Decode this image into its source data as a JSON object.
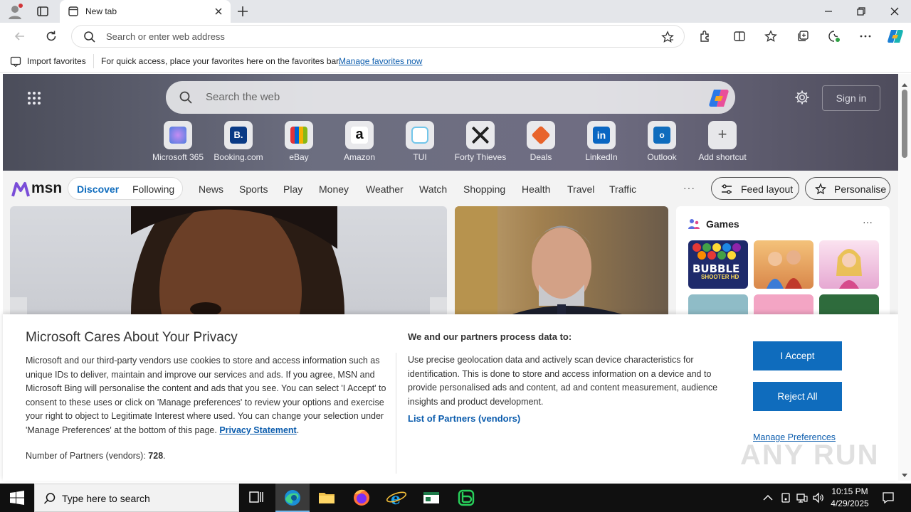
{
  "browser": {
    "tab_title": "New tab",
    "address_placeholder": "Search or enter web address"
  },
  "favorites_bar": {
    "import_label": "Import favorites",
    "message": "For quick access, place your favorites here on the favorites bar.",
    "manage_link": "Manage favorites now"
  },
  "newtab": {
    "search_placeholder": "Search the web",
    "sign_in": "Sign in",
    "shortcuts": [
      {
        "label": "Microsoft 365",
        "color": "#7b5cc9"
      },
      {
        "label": "Booking.com",
        "color": "#0a3a85"
      },
      {
        "label": "eBay",
        "color": "#e53238"
      },
      {
        "label": "Amazon",
        "color": "#222222"
      },
      {
        "label": "TUI",
        "color": "#72c6ea"
      },
      {
        "label": "Forty Thieves",
        "color": "#333333"
      },
      {
        "label": "Deals",
        "color": "#e8632b"
      },
      {
        "label": "LinkedIn",
        "color": "#0a66c2"
      },
      {
        "label": "Outlook",
        "color": "#0f6cbd"
      },
      {
        "label": "Add shortcut",
        "color": "#555555"
      }
    ]
  },
  "msn": {
    "logo": "msn",
    "tab_active": "Discover",
    "tab_other": "Following",
    "nav": [
      "News",
      "Sports",
      "Play",
      "Money",
      "Weather",
      "Watch",
      "Shopping",
      "Health",
      "Travel",
      "Traffic"
    ],
    "more": "···",
    "feed_layout": "Feed layout",
    "personalise": "Personalise",
    "games_title": "Games",
    "games_more": "···",
    "bubble_title": "BUBBLE",
    "bubble_sub": "SHOOTER HD"
  },
  "consent": {
    "title": "Microsoft Cares About Your Privacy",
    "body": "Microsoft and our third-party vendors use cookies to store and access information such as unique IDs to deliver, maintain and improve our services and ads. If you agree, MSN and Microsoft Bing will personalise the content and ads that you see. You can select 'I Accept' to consent to these uses or click on 'Manage preferences' to review your options and exercise your right to object to Legitimate Interest where used.  You can change your selection under 'Manage Preferences' at the bottom of this page.",
    "privacy_link": "Privacy Statement",
    "partners_count_label": "Number of Partners (vendors):",
    "partners_count": "728",
    "partners_count_end": ".",
    "subtitle": "We and our partners process data to:",
    "purpose": "Use precise geolocation data and actively scan device characteristics for identification. This is done to store and access information on a device and to provide personalised ads and content, ad and content measurement, audience insights and product development.",
    "partners_link": "List of Partners (vendors)",
    "accept": "I Accept",
    "reject": "Reject All",
    "manage": "Manage Preferences"
  },
  "watermark": "ANY RUN",
  "taskbar": {
    "search_placeholder": "Type here to search",
    "time": "10:15 PM",
    "date": "4/29/2025"
  }
}
